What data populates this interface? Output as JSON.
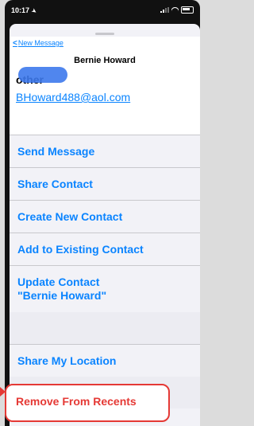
{
  "status_bar": {
    "time": "10:17",
    "signal_icon": "cell-signal-icon",
    "wifi_icon": "wifi-icon",
    "battery_icon": "battery-icon"
  },
  "nav": {
    "back_label": "New Message",
    "back_icon": "chevron-left-icon"
  },
  "contact": {
    "name": "Bernie Howard",
    "email_label": "other",
    "email_value": "BHoward488@aol.com"
  },
  "actions": [
    {
      "label": "Send Message"
    },
    {
      "label": "Share Contact"
    },
    {
      "label": "Create New Contact"
    },
    {
      "label": "Add to Existing Contact"
    },
    {
      "label": "Update Contact"
    },
    {
      "label": "\"Bernie Howard\""
    }
  ],
  "location": {
    "label": "Share My Location"
  },
  "recents": {
    "label": "Remove From Recents",
    "highlight_color": "#e53935"
  },
  "colors": {
    "accent": "#0a84ff",
    "destructive": "#e53935"
  }
}
